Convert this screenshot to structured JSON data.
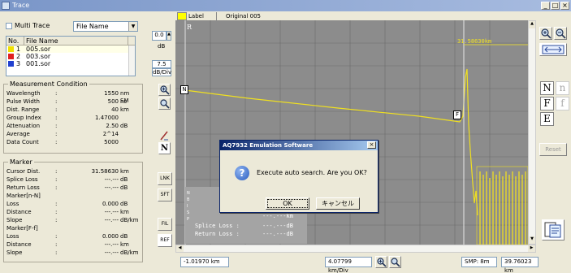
{
  "window": {
    "title": "Trace",
    "min": "_",
    "max": "□",
    "close": "×"
  },
  "left": {
    "multi_trace_label": "Multi Trace",
    "file_select_value": "File Name",
    "file_table": {
      "headers": [
        "No.",
        "File Name"
      ],
      "rows": [
        {
          "no": "1",
          "name": "005.sor",
          "color": "#f0e000"
        },
        {
          "no": "2",
          "name": "003.sor",
          "color": "#e02020"
        },
        {
          "no": "3",
          "name": "001.sor",
          "color": "#2040d0"
        }
      ]
    },
    "measurement": {
      "title": "Measurement Condition",
      "rows": [
        {
          "label": "Wavelength",
          "value": "1550",
          "unit": "nm SM"
        },
        {
          "label": "Pulse Width",
          "value": "500",
          "unit": "ns"
        },
        {
          "label": "Dist. Range",
          "value": "40",
          "unit": "km"
        },
        {
          "label": "Group Index",
          "value": "1.47000",
          "unit": ""
        },
        {
          "label": "Attenuation",
          "value": "2.50",
          "unit": "dB"
        },
        {
          "label": "Average",
          "value": "2^14",
          "unit": ""
        },
        {
          "label": "Data Count",
          "value": "5000",
          "unit": ""
        }
      ]
    },
    "marker": {
      "title": "Marker",
      "rows": [
        {
          "label": "Cursor Dist.",
          "value": "31.58630",
          "unit": "km"
        },
        {
          "label": "Splice Loss",
          "value": "---.---",
          "unit": "dB"
        },
        {
          "label": "Return Loss",
          "value": "---.---",
          "unit": "dB"
        },
        {
          "label": "Marker[n-N]",
          "value": "",
          "unit": ""
        },
        {
          "label": "  Loss",
          "value": "0.000",
          "unit": "dB"
        },
        {
          "label": "  Distance",
          "value": "---.---",
          "unit": "km"
        },
        {
          "label": "  Slope",
          "value": "---.---",
          "unit": "dB/km"
        },
        {
          "label": "Marker[F-f]",
          "value": "",
          "unit": ""
        },
        {
          "label": "  Loss",
          "value": "0.000",
          "unit": "dB"
        },
        {
          "label": "  Distance",
          "value": "---.---",
          "unit": "km"
        },
        {
          "label": "  Slope",
          "value": "---.---",
          "unit": "dB/km"
        }
      ]
    }
  },
  "toolbar": {
    "offset_value": "0.0",
    "offset_unit": "dB",
    "scale_value": "7.5",
    "scale_unit": "dB/Div",
    "lnk": "LNK",
    "sft": "SFT",
    "fil": "FIL",
    "ref": "REF",
    "n_marker": "N"
  },
  "plot": {
    "header_label": "Label",
    "header_original": "Original 005",
    "r_label": "R",
    "cursor_readout": "31.58630km",
    "overlay_lines": [
      "Splice Loss :",
      "Return Loss :"
    ],
    "overlay_vals": [
      "---.---km",
      "---.---dB",
      "---.---dB"
    ],
    "marker_n": "N",
    "marker_f": "F",
    "side_letters": "N  B  I  S  P"
  },
  "status": {
    "left": "-1.01970 km",
    "mid": "4.07799 km/Div",
    "smp": "SMP: 8m",
    "right": "39.76023 km"
  },
  "right": {
    "n": "N",
    "n_small": "n",
    "f": "F",
    "f_small": "f",
    "e": "E",
    "reset": "Reset"
  },
  "dialog": {
    "title": "AQ7932 Emulation Software",
    "message": "Execute auto search. Are you OK?",
    "ok": "OK",
    "cancel": "キャンセル",
    "close": "×"
  }
}
